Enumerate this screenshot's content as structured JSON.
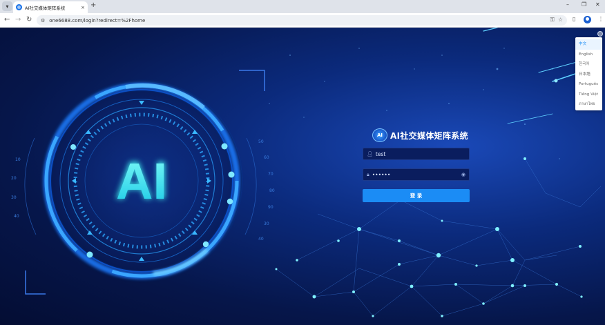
{
  "browser": {
    "tab_title": "AI社交媒体矩阵系统",
    "tab_close": "×",
    "new_tab": "+",
    "menu_icon": "chevron-down-icon",
    "url": "one6688.com/login?redirect=%2Fhome",
    "window_controls": {
      "minimize": "–",
      "restore": "❐",
      "close": "✕"
    },
    "nav": {
      "back": "←",
      "forward": "→",
      "reload": "↻"
    }
  },
  "hero": {
    "emblem_text": "AI",
    "dial_numbers": [
      "10",
      "20",
      "30",
      "40",
      "50",
      "60",
      "70",
      "80",
      "90",
      "30",
      "40",
      "50"
    ]
  },
  "login": {
    "brand_logo_text": "AI",
    "brand_name": "AI社交媒体矩阵系统",
    "username_value": "test",
    "password_value": "••••••",
    "submit_label": "登 录"
  },
  "language_menu": {
    "items": [
      "中文",
      "English",
      "한국어",
      "日本語",
      "Português",
      "Tiếng Việt",
      "ภาษาไทย"
    ],
    "selected": "中文"
  },
  "colors": {
    "accent": "#1b8cf5",
    "page_bg": "#06164a",
    "ring_glow": "#1e9bff",
    "emblem": "#3cf2f0"
  }
}
